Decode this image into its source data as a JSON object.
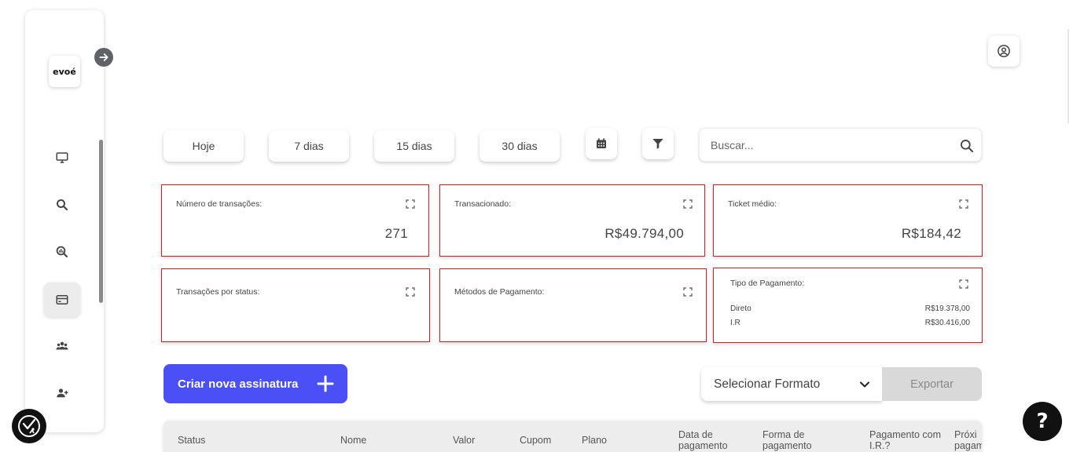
{
  "brand": {
    "logo_text": "evoé"
  },
  "filters": {
    "today": "Hoje",
    "days7": "7 dias",
    "days15": "15 dias",
    "days30": "30 dias"
  },
  "search": {
    "placeholder": "Buscar..."
  },
  "cards": {
    "transactions_count": {
      "label": "Número de transações:",
      "value": "271"
    },
    "transacted": {
      "label": "Transacionado:",
      "value": "R$49.794,00"
    },
    "avg_ticket": {
      "label": "Ticket médio:",
      "value": "R$184,42"
    },
    "by_status": {
      "label": "Transações por status:"
    },
    "payment_methods": {
      "label": "Métodos de Pagamento:"
    },
    "payment_type": {
      "label": "Tipo de Pagamento:",
      "rows": [
        {
          "name": "Direto",
          "value": "R$19.378,00"
        },
        {
          "name": "I.R",
          "value": "R$30.416,00"
        }
      ]
    }
  },
  "actions": {
    "create": "Criar nova assinatura",
    "select_format": "Selecionar Formato",
    "export": "Exportar"
  },
  "table": {
    "columns": [
      "Status",
      "Nome",
      "Valor",
      "Cupom",
      "Plano",
      "Data de pagamento",
      "Forma de pagamento",
      "Pagamento com I.R.?",
      "Próxi pagam"
    ]
  },
  "help": {
    "label": "?"
  },
  "colors": {
    "accent": "#4a50f5",
    "card_border": "#cf2027"
  },
  "icons": [
    "monitor-icon",
    "search-icon",
    "analytics-search-icon",
    "credit-card-icon",
    "users-icon",
    "add-user-icon",
    "arrow-right-icon",
    "user-circle-icon",
    "calendar-icon",
    "filter-icon",
    "expand-icon",
    "plus-icon",
    "chevron-down-icon",
    "accessibility-icon"
  ]
}
